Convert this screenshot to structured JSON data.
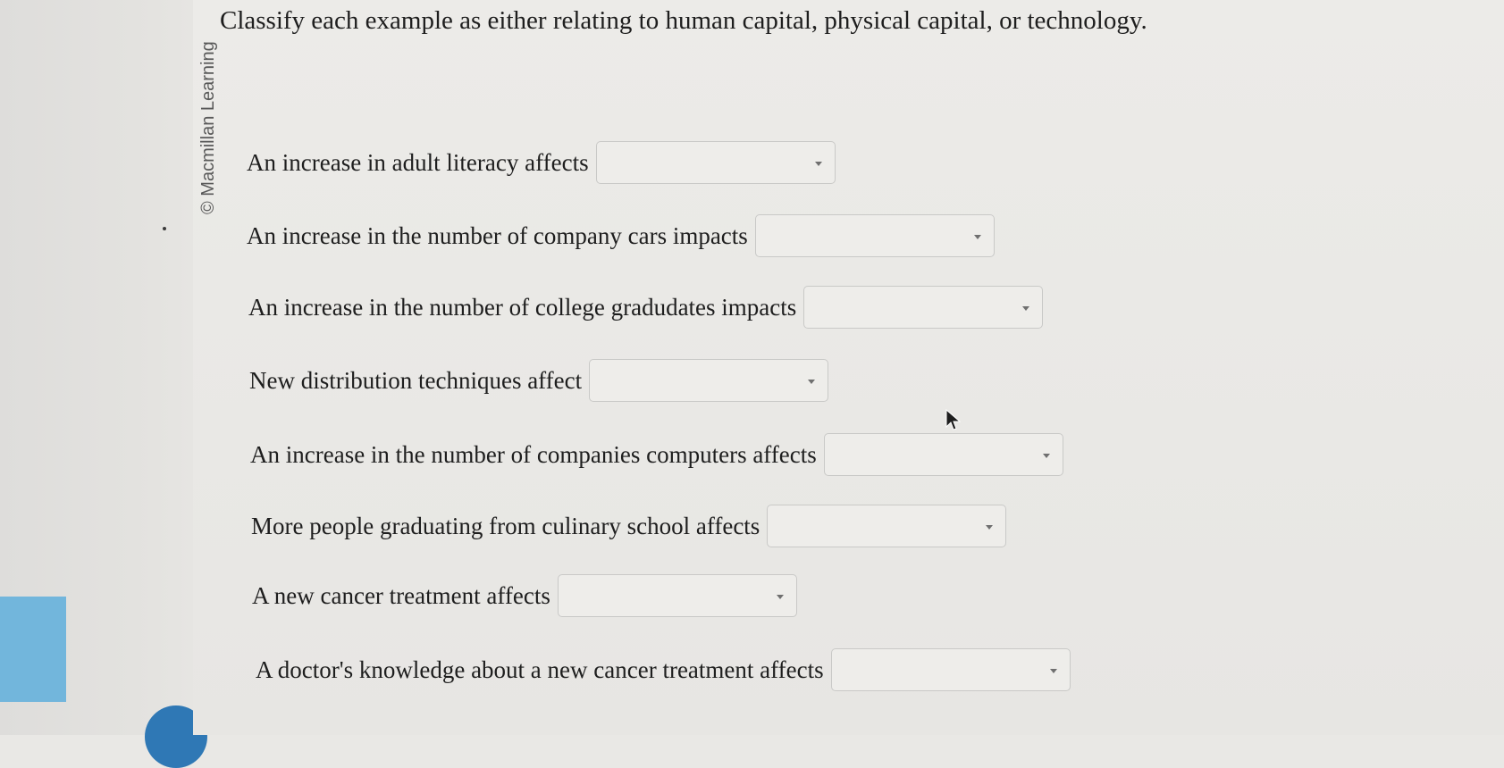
{
  "copyright": "© Macmillan Learning",
  "question": "Classify each example as either relating to human capital, physical capital, or technology.",
  "items": [
    {
      "label": "An increase in adult literacy affects",
      "value": ""
    },
    {
      "label": "An increase in the number of company cars impacts",
      "value": ""
    },
    {
      "label": "An increase in the number of college gradudates impacts",
      "value": ""
    },
    {
      "label": "New distribution techniques affect",
      "value": ""
    },
    {
      "label": "An increase in the number of companies computers affects",
      "value": ""
    },
    {
      "label": "More people graduating from culinary school affects",
      "value": ""
    },
    {
      "label": "A new cancer treatment affects",
      "value": ""
    },
    {
      "label": "A doctor's knowledge about a new cancer treatment affects",
      "value": ""
    }
  ],
  "colors": {
    "page_background": "#e9e8e5",
    "select_border": "#c9c9c7",
    "panel_highlight": "#72b6dc",
    "panel_circle": "#2f78b5"
  },
  "icons": {
    "dropdown": "chevron-down-icon",
    "cursor": "mouse-pointer-icon"
  }
}
